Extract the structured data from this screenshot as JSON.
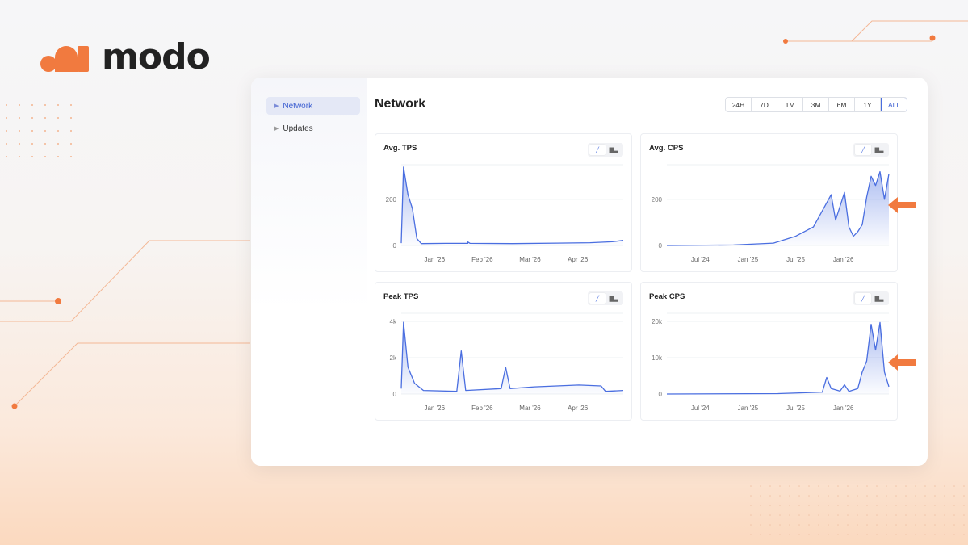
{
  "brand": {
    "name": "modo",
    "accent": "#f17a3f"
  },
  "sidebar": {
    "items": [
      {
        "label": "Network",
        "active": true
      },
      {
        "label": "Updates",
        "active": false
      }
    ]
  },
  "header": {
    "title": "Network"
  },
  "time_ranges": {
    "options": [
      "24H",
      "7D",
      "1M",
      "3M",
      "6M",
      "1Y",
      "ALL"
    ],
    "selected": "ALL"
  },
  "icons": {
    "line_chart": "line-chart-icon",
    "bar_chart": "bar-chart-icon",
    "caret": "caret-right-icon",
    "arrow": "arrow-left-icon"
  },
  "chart_data": [
    {
      "type": "area",
      "title": "Avg. TPS",
      "x_tick_labels": [
        "Jan '26",
        "Feb '26",
        "Mar '26",
        "Apr '26"
      ],
      "y_tick_labels": [
        "0",
        "200"
      ],
      "ylim": [
        0,
        350
      ],
      "x": [
        0,
        0.01,
        0.03,
        0.05,
        0.07,
        0.09,
        0.2,
        0.3,
        0.3,
        0.31,
        0.5,
        0.7,
        0.85,
        0.95,
        1.0
      ],
      "values": [
        10,
        340,
        220,
        160,
        30,
        8,
        9,
        9,
        15,
        9,
        8,
        10,
        12,
        16,
        22
      ],
      "color": "#4a6ee0"
    },
    {
      "type": "area",
      "title": "Avg. CPS",
      "x_tick_labels": [
        "Jul '24",
        "Jan '25",
        "Jul '25",
        "Jan '26"
      ],
      "y_tick_labels": [
        "0",
        "200"
      ],
      "ylim": [
        0,
        350
      ],
      "x": [
        0,
        0.3,
        0.48,
        0.58,
        0.66,
        0.7,
        0.74,
        0.76,
        0.8,
        0.82,
        0.84,
        0.86,
        0.88,
        0.9,
        0.92,
        0.94,
        0.96,
        0.98,
        1.0
      ],
      "values": [
        0,
        2,
        10,
        40,
        80,
        150,
        220,
        110,
        230,
        80,
        40,
        60,
        90,
        210,
        300,
        260,
        320,
        200,
        310
      ],
      "color": "#4a6ee0"
    },
    {
      "type": "area",
      "title": "Peak TPS",
      "x_tick_labels": [
        "Jan '26",
        "Feb '26",
        "Mar '26",
        "Apr '26"
      ],
      "y_tick_labels": [
        "0",
        "2k",
        "4k"
      ],
      "ylim": [
        0,
        4500
      ],
      "x": [
        0,
        0.01,
        0.03,
        0.06,
        0.1,
        0.25,
        0.27,
        0.29,
        0.45,
        0.47,
        0.49,
        0.6,
        0.8,
        0.9,
        0.92,
        1.0
      ],
      "values": [
        300,
        4000,
        1500,
        600,
        200,
        150,
        2400,
        200,
        300,
        1500,
        300,
        400,
        500,
        450,
        150,
        200
      ],
      "color": "#4a6ee0"
    },
    {
      "type": "area",
      "title": "Peak CPS",
      "x_tick_labels": [
        "Jul '24",
        "Jan '25",
        "Jul '25",
        "Jan '26"
      ],
      "y_tick_labels": [
        "0",
        "10k",
        "20k"
      ],
      "ylim": [
        0,
        22000
      ],
      "x": [
        0,
        0.5,
        0.7,
        0.72,
        0.74,
        0.78,
        0.8,
        0.82,
        0.86,
        0.88,
        0.9,
        0.92,
        0.94,
        0.96,
        0.98,
        1.0
      ],
      "values": [
        0,
        100,
        500,
        4500,
        1500,
        800,
        2500,
        700,
        1500,
        6000,
        9000,
        19000,
        12000,
        19500,
        6000,
        2000
      ],
      "color": "#4a6ee0"
    }
  ]
}
